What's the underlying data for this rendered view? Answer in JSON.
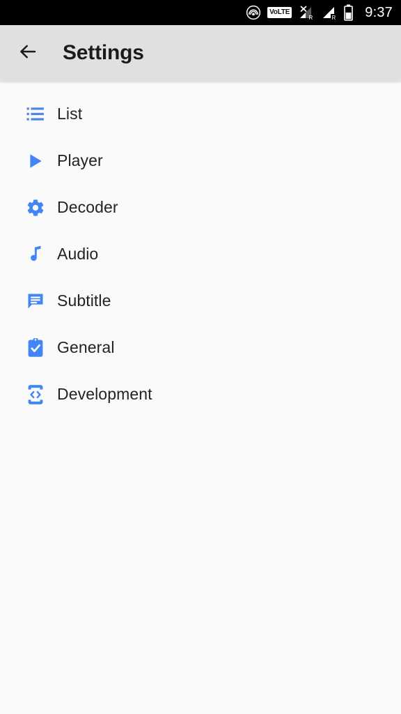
{
  "status_bar": {
    "icons": [
      {
        "name": "cast-icon",
        "label": "cast"
      },
      {
        "name": "volte-icon",
        "label": "VoLTE"
      },
      {
        "name": "signal-no-service-roaming-icon",
        "label": "R"
      },
      {
        "name": "signal-roaming-icon",
        "label": "R"
      },
      {
        "name": "battery-icon",
        "label": "battery"
      }
    ],
    "volte_text": "VoLTE",
    "roaming_label": "R",
    "time": "9:37"
  },
  "toolbar": {
    "back_icon": "arrow-back-icon",
    "title": "Settings"
  },
  "settings": {
    "items": [
      {
        "label": "List",
        "icon": "list-icon"
      },
      {
        "label": "Player",
        "icon": "play-icon"
      },
      {
        "label": "Decoder",
        "icon": "gear-icon"
      },
      {
        "label": "Audio",
        "icon": "music-note-icon"
      },
      {
        "label": "Subtitle",
        "icon": "speech-bubble-icon"
      },
      {
        "label": "General",
        "icon": "clipboard-check-icon"
      },
      {
        "label": "Development",
        "icon": "device-code-icon"
      }
    ]
  },
  "colors": {
    "accent_blue": "#4285f4",
    "toolbar_bg": "#e0e0e0",
    "content_bg": "#fafafa",
    "status_bg": "#000000",
    "text": "#232323"
  }
}
